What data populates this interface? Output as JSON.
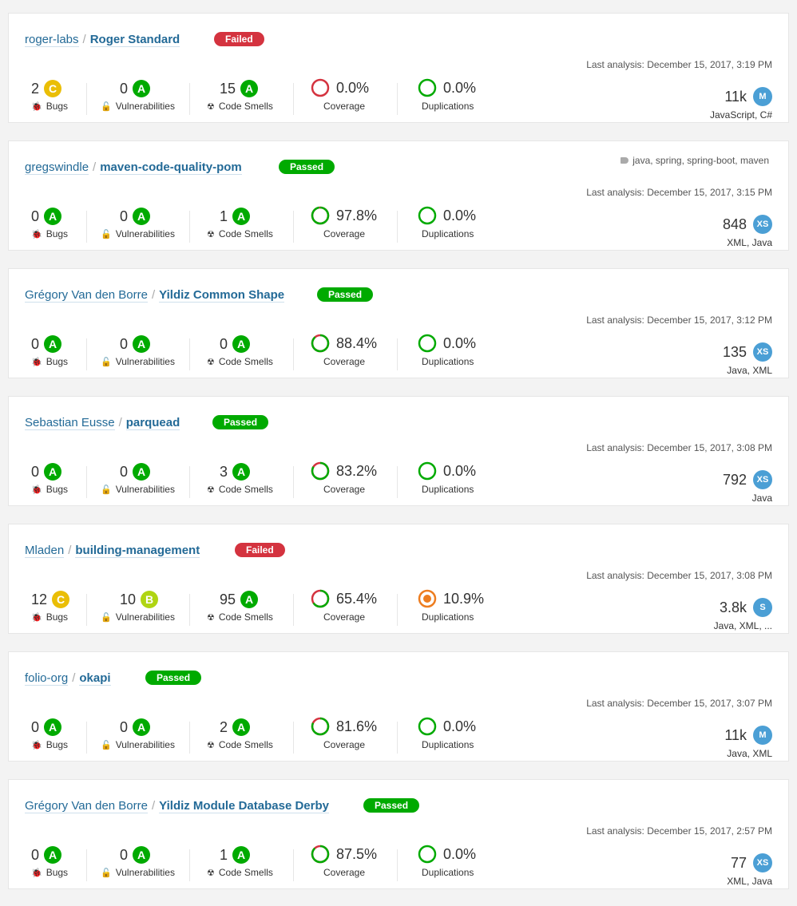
{
  "labels": {
    "last_analysis_prefix": "Last analysis:",
    "bugs": "Bugs",
    "vulnerabilities": "Vulnerabilities",
    "code_smells": "Code Smells",
    "coverage": "Coverage",
    "duplications": "Duplications"
  },
  "colors": {
    "failed": "#d4333f",
    "passed": "#00aa00",
    "rating_A": "#00aa00",
    "rating_B": "#b0d513",
    "rating_C": "#eabe06",
    "coverage_bad": "#d4333f",
    "coverage_good": "#00aa00",
    "duplication_warn": "#ed7d20",
    "link": "#236a97"
  },
  "projects": [
    {
      "org": "roger-labs",
      "name": "Roger Standard",
      "gate": "Failed",
      "tags": "",
      "last_analysis": "December 15, 2017, 3:19 PM",
      "bugs": "2",
      "bugs_rating": "C",
      "vulnerabilities": "0",
      "vulnerabilities_rating": "A",
      "code_smells": "15",
      "code_smells_rating": "A",
      "coverage": "0.0%",
      "duplications": "0.0%",
      "size": "11k",
      "size_rating": "M",
      "languages": "JavaScript, C#"
    },
    {
      "org": "gregswindle",
      "name": "maven-code-quality-pom",
      "gate": "Passed",
      "tags": "java, spring, spring-boot, maven",
      "last_analysis": "December 15, 2017, 3:15 PM",
      "bugs": "0",
      "bugs_rating": "A",
      "vulnerabilities": "0",
      "vulnerabilities_rating": "A",
      "code_smells": "1",
      "code_smells_rating": "A",
      "coverage": "97.8%",
      "duplications": "0.0%",
      "size": "848",
      "size_rating": "XS",
      "languages": "XML, Java"
    },
    {
      "org": "Grégory Van den Borre",
      "name": "Yildiz Common Shape",
      "gate": "Passed",
      "tags": "",
      "last_analysis": "December 15, 2017, 3:12 PM",
      "bugs": "0",
      "bugs_rating": "A",
      "vulnerabilities": "0",
      "vulnerabilities_rating": "A",
      "code_smells": "0",
      "code_smells_rating": "A",
      "coverage": "88.4%",
      "duplications": "0.0%",
      "size": "135",
      "size_rating": "XS",
      "languages": "Java, XML"
    },
    {
      "org": "Sebastian Eusse",
      "name": "parquead",
      "gate": "Passed",
      "tags": "",
      "last_analysis": "December 15, 2017, 3:08 PM",
      "bugs": "0",
      "bugs_rating": "A",
      "vulnerabilities": "0",
      "vulnerabilities_rating": "A",
      "code_smells": "3",
      "code_smells_rating": "A",
      "coverage": "83.2%",
      "duplications": "0.0%",
      "size": "792",
      "size_rating": "XS",
      "languages": "Java"
    },
    {
      "org": "Mladen",
      "name": "building-management",
      "gate": "Failed",
      "tags": "",
      "last_analysis": "December 15, 2017, 3:08 PM",
      "bugs": "12",
      "bugs_rating": "C",
      "vulnerabilities": "10",
      "vulnerabilities_rating": "B",
      "code_smells": "95",
      "code_smells_rating": "A",
      "coverage": "65.4%",
      "duplications": "10.9%",
      "size": "3.8k",
      "size_rating": "S",
      "languages": "Java, XML, ..."
    },
    {
      "org": "folio-org",
      "name": "okapi",
      "gate": "Passed",
      "tags": "",
      "last_analysis": "December 15, 2017, 3:07 PM",
      "bugs": "0",
      "bugs_rating": "A",
      "vulnerabilities": "0",
      "vulnerabilities_rating": "A",
      "code_smells": "2",
      "code_smells_rating": "A",
      "coverage": "81.6%",
      "duplications": "0.0%",
      "size": "11k",
      "size_rating": "M",
      "languages": "Java, XML"
    },
    {
      "org": "Grégory Van den Borre",
      "name": "Yildiz Module Database Derby",
      "gate": "Passed",
      "tags": "",
      "last_analysis": "December 15, 2017, 2:57 PM",
      "bugs": "0",
      "bugs_rating": "A",
      "vulnerabilities": "0",
      "vulnerabilities_rating": "A",
      "code_smells": "1",
      "code_smells_rating": "A",
      "coverage": "87.5%",
      "duplications": "0.0%",
      "size": "77",
      "size_rating": "XS",
      "languages": "XML, Java"
    }
  ]
}
